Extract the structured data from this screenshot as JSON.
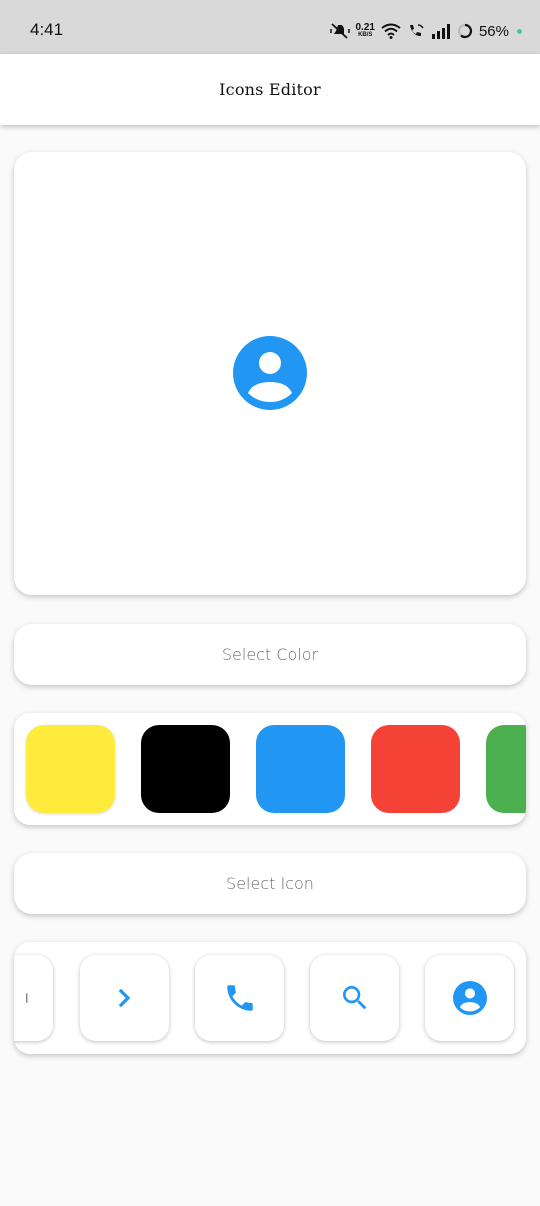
{
  "status_bar": {
    "time": "4:41",
    "net_speed_value": "0.21",
    "net_speed_unit": "KB/S",
    "battery": "56%"
  },
  "app_bar": {
    "title": "Icons Editor"
  },
  "preview": {
    "icon": "account-circle-icon",
    "icon_color": "#2196f3"
  },
  "color_section": {
    "button_label": "Select Color"
  },
  "colors": [
    "#ffeb3b",
    "#000000",
    "#2196f3",
    "#f44336",
    "#4caf50"
  ],
  "icon_section": {
    "button_label": "Select Icon"
  },
  "icons": [
    "partial-icon",
    "chevron-right-icon",
    "phone-icon",
    "search-icon",
    "account-circle-icon"
  ],
  "accent": "#2196f3"
}
